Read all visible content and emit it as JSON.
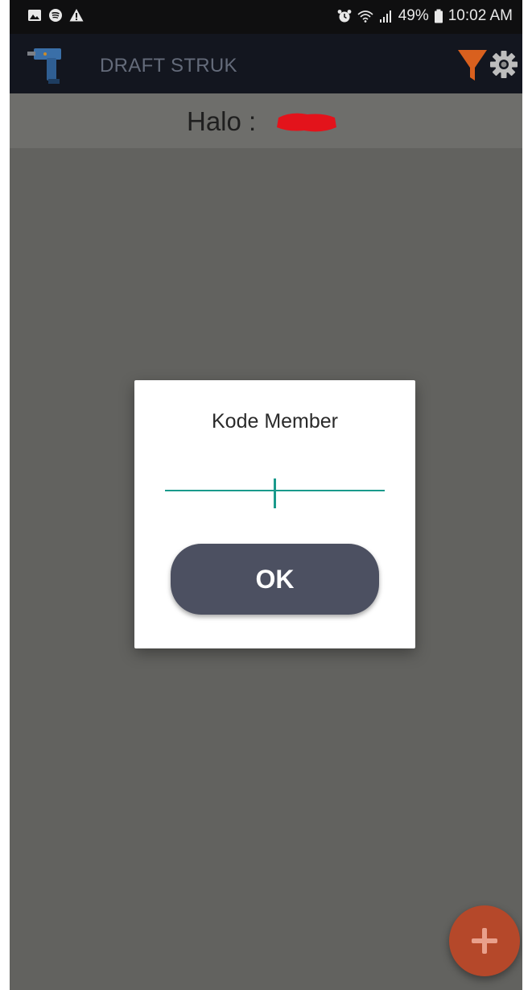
{
  "status_bar": {
    "battery": "49%",
    "time": "10:02 AM",
    "icons": [
      "gallery-icon",
      "spotify-icon",
      "warning-icon",
      "alarm-icon",
      "wifi-icon",
      "signal-icon",
      "battery-icon"
    ]
  },
  "app_bar": {
    "title": "DRAFT STRUK",
    "icons": [
      "drill-logo-icon",
      "filter-icon",
      "gear-icon"
    ],
    "colors": {
      "background": "#13161f",
      "title": "#646b7a",
      "filter": "#d9601e"
    }
  },
  "greeting": {
    "text": "Halo :"
  },
  "dialog": {
    "title": "Kode Member",
    "input_value": "",
    "ok_label": "OK",
    "colors": {
      "underline": "#1a9a8c",
      "button": "#4c5061"
    }
  },
  "fab": {
    "icon": "plus-icon",
    "color": "#b5482a"
  },
  "overlay": {
    "color": "#62625f"
  }
}
